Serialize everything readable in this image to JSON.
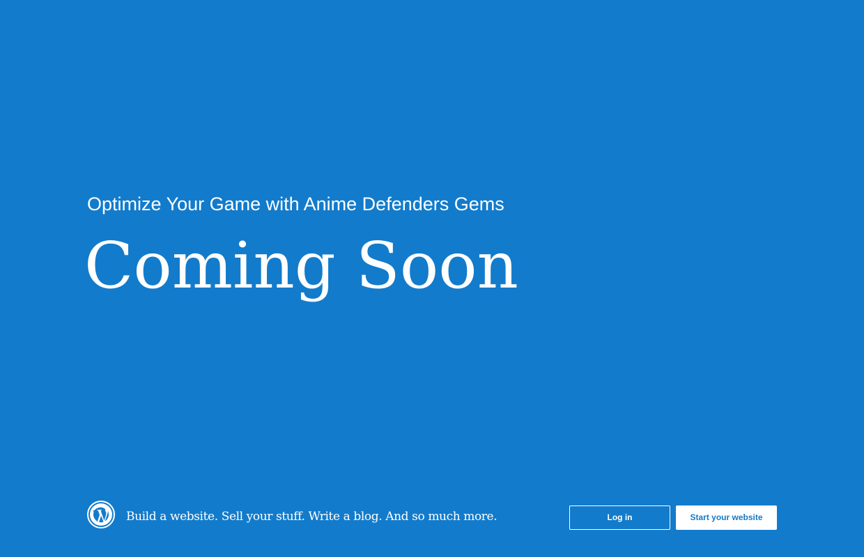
{
  "colors": {
    "background": "#137bcb",
    "text": "#ffffff",
    "button_fill": "#ffffff",
    "button_text_accent": "#137bcb"
  },
  "page": {
    "site_title": "Optimize Your Game with Anime Defenders Gems",
    "headline": "Coming Soon"
  },
  "footer": {
    "logo_icon": "wordpress-logo-icon",
    "tagline": "Build a website. Sell your stuff. Write a blog. And so much more.",
    "login_label": "Log in",
    "start_label": "Start your website"
  }
}
